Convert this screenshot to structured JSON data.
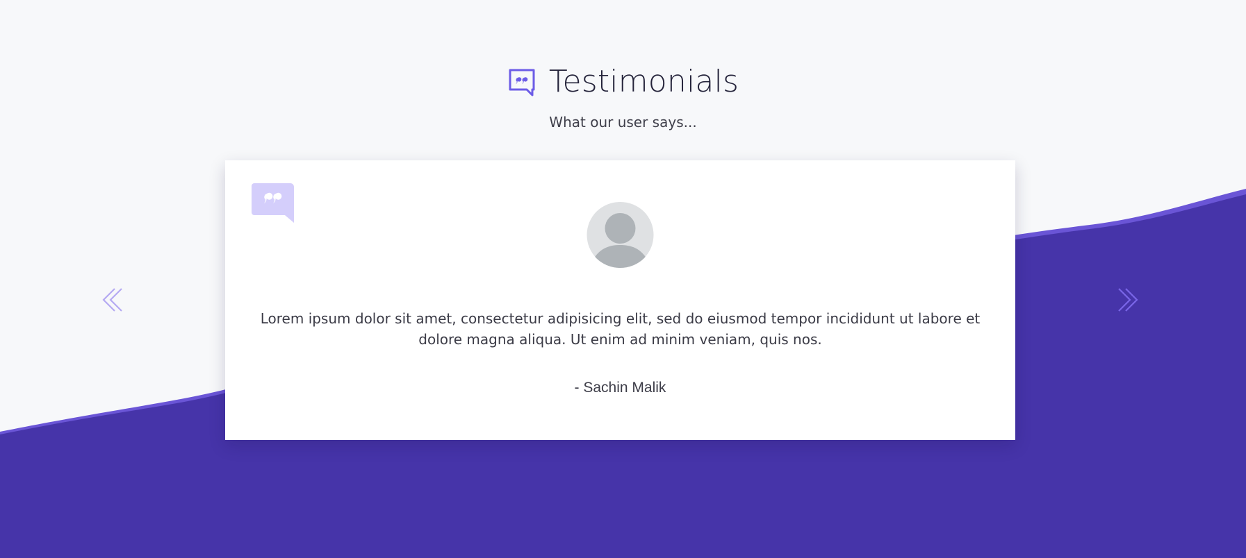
{
  "section": {
    "title": "Testimonials",
    "subtitle": "What our user says...",
    "title_icon": "speech-bubble-quote-icon"
  },
  "testimonial": {
    "quote_icon": "speech-bubble-quote-icon",
    "avatar_icon": "user-avatar-placeholder",
    "text": "Lorem ipsum dolor sit amet, consectetur adipisicing elit, sed do eiusmod tempor incididunt ut labore et dolore magna aliqua. Ut enim ad minim veniam, quis nos.",
    "author": "- Sachin Malik"
  },
  "controls": {
    "prev_icon": "double-chevron-left-icon",
    "next_icon": "double-chevron-right-icon"
  },
  "colors": {
    "background": "#f7f8fa",
    "brand_purple": "#4634a9",
    "accent_purple": "#6c5ce7",
    "icon_light": "#d4cefb",
    "text_dark": "#24233a"
  }
}
